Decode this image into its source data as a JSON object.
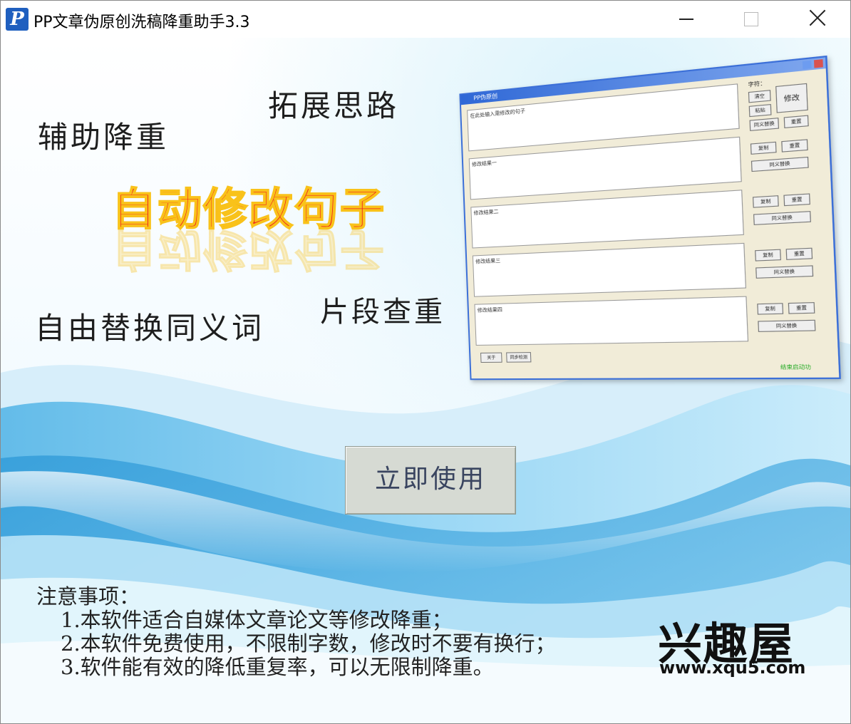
{
  "window": {
    "title": "PP文章伪原创洗稿降重助手3.3",
    "icon": "pp-logo-icon",
    "controls": {
      "minimize": "minimize-icon",
      "maximize": "maximize-icon",
      "close": "close-icon"
    }
  },
  "slogans": {
    "assist": "辅助降重",
    "expand": "拓展思路",
    "synonym": "自由替换同义词",
    "segment": "片段查重"
  },
  "hero": {
    "text": "自动修改句子",
    "color": "#ee1e1e",
    "outline": "#f9c21a"
  },
  "preview": {
    "window_title": "PP伪原创",
    "input_placeholder": "在此处输入需修改的句子",
    "result_labels": [
      "修改结果一",
      "修改结果二",
      "修改结果三",
      "修改结果四"
    ],
    "side_label": "字符：",
    "buttons": {
      "clear": "清空",
      "paste": "粘贴",
      "modify": "修改",
      "synonym_replace": "同义替换",
      "reset": "重置",
      "copy": "复制"
    },
    "bottom_buttons": [
      "关于",
      "同步检测"
    ],
    "footer_note": "结束启动功"
  },
  "use_button": {
    "label": "立即使用"
  },
  "notes": {
    "title": "注意事项：",
    "items": [
      "1.本软件适合自媒体文章论文等修改降重；",
      "2.本软件免费使用，不限制字数，修改时不要有换行；",
      "3.软件能有效的降低重复率，可以无限制降重。"
    ]
  },
  "branding": {
    "logo": "兴趣屋",
    "url": "www.xqu5.com"
  }
}
